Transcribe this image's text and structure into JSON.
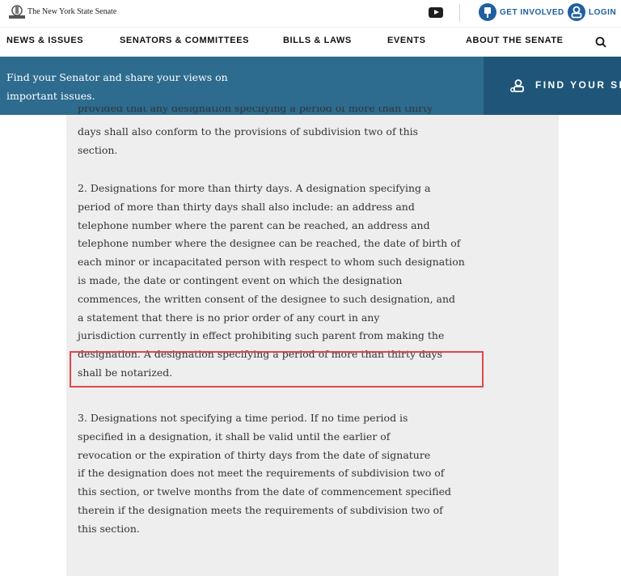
{
  "header": {
    "site_name": "The New York State Senate",
    "get_involved": "GET INVOLVED",
    "login": "LOGIN"
  },
  "nav": {
    "items": [
      "NEWS & ISSUES",
      "SENATORS & COMMITTEES",
      "BILLS & LAWS",
      "EVENTS",
      "ABOUT THE SENATE"
    ]
  },
  "banner": {
    "line1": "Find your Senator and share your views on",
    "line2": "important issues.",
    "cta": "FIND YOUR SE"
  },
  "content": {
    "cut_line": "provided that any designation specifying a period of more than thirty",
    "p0": [
      "days shall also conform to the provisions of subdivision two of this",
      "section."
    ],
    "p1": [
      "2. Designations for more than thirty days. A designation specifying a",
      "period of more than thirty days shall also include: an address and",
      "telephone number where the parent can be reached, an address and",
      "telephone number where the designee can be reached, the date of birth of",
      "each minor or incapacitated person with respect to whom such designation",
      "is made, the date or contingent event on which the designation",
      "commences, the written consent of the designee to such designation, and",
      "a statement that there is no prior order of any court in any",
      "jurisdiction currently in effect prohibiting such parent from making the",
      "designation. A designation specifying a period of more than thirty days",
      "shall be notarized."
    ],
    "p2": [
      "3. Designations not specifying a time period. If no time period is",
      "specified in a designation, it shall be valid until the earlier of",
      "revocation or the expiration of thirty days from the date of signature",
      "if the designation does not meet the requirements of subdivision two of",
      "this section, or twelve months from the date of commencement specified",
      "therein if the designation meets the requirements of subdivision two of",
      "this section."
    ]
  },
  "colors": {
    "brand_blue": "#1f5fa0",
    "banner": "#2d6b8f",
    "banner_cta": "#1f5578",
    "highlight_border": "#e0474c"
  }
}
